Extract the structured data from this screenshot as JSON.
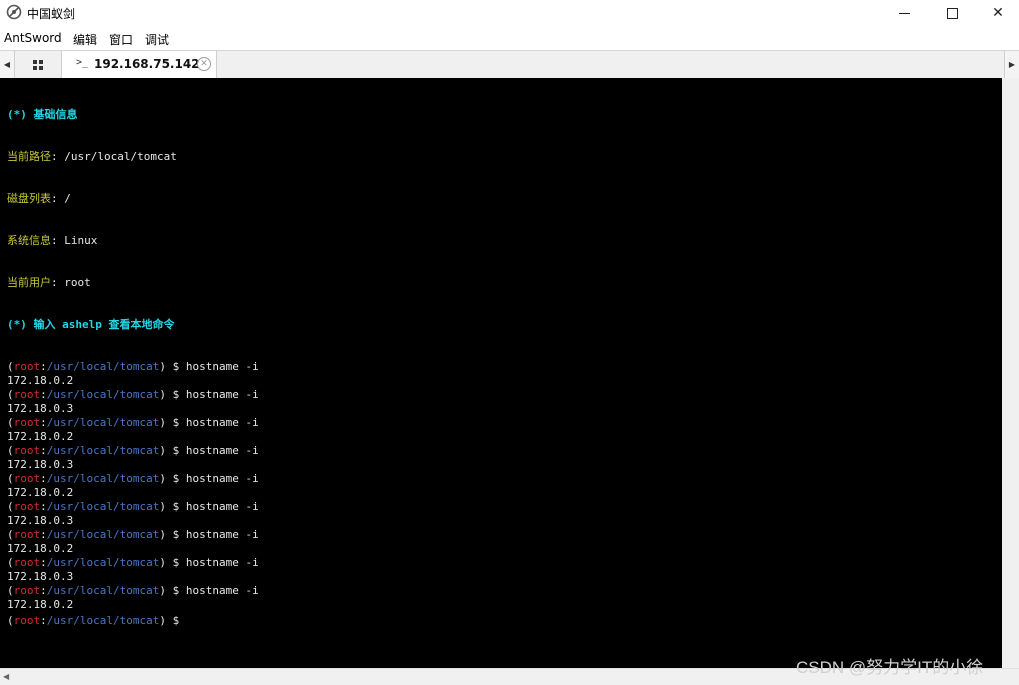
{
  "window": {
    "title": "中国蚁剑",
    "controls": {
      "minimize_icon": "minimize-icon",
      "maximize_icon": "maximize-icon",
      "close_icon": "close-icon",
      "close_glyph": "✕"
    }
  },
  "menu": {
    "items": [
      "AntSword",
      "编辑",
      "窗口",
      "调试"
    ]
  },
  "tabs": {
    "scroll_left_glyph": "◀",
    "scroll_right_glyph": "▶",
    "active": {
      "prompt_glyph": ">_",
      "label": "192.168.75.142",
      "close_glyph": "✕"
    }
  },
  "terminal": {
    "header": {
      "info_title": "(*) 基础信息",
      "path_label": "当前路径",
      "path_value": ": /usr/local/tomcat",
      "disk_label": "磁盘列表",
      "disk_value": ": /",
      "sys_label": "系统信息",
      "sys_value": ": Linux",
      "user_label": "当前用户",
      "user_value": ": root",
      "help_title": "(*) 输入 ashelp 查看本地命令"
    },
    "prompt": {
      "open": "(",
      "user": "root",
      "sep": ":",
      "path": "/usr/local/tomcat",
      "close": ") $ "
    },
    "commands": [
      {
        "cmd": "hostname -i",
        "output": "172.18.0.2"
      },
      {
        "cmd": "hostname -i",
        "output": "172.18.0.3"
      },
      {
        "cmd": "hostname -i",
        "output": "172.18.0.2"
      },
      {
        "cmd": "hostname -i",
        "output": "172.18.0.3"
      },
      {
        "cmd": "hostname -i",
        "output": "172.18.0.2"
      },
      {
        "cmd": "hostname -i",
        "output": "172.18.0.3"
      },
      {
        "cmd": "hostname -i",
        "output": "172.18.0.2"
      },
      {
        "cmd": "hostname -i",
        "output": "172.18.0.3"
      },
      {
        "cmd": "hostname -i",
        "output": "172.18.0.2"
      }
    ]
  },
  "scrollbar": {
    "left_glyph": "◀"
  },
  "watermark": "CSDN @努力学IT的小徐",
  "colors": {
    "prompt_user": "#d62a2a",
    "prompt_path": "#4a76c4",
    "info_title": "#22d6e6",
    "info_label": "#c8c83a"
  }
}
